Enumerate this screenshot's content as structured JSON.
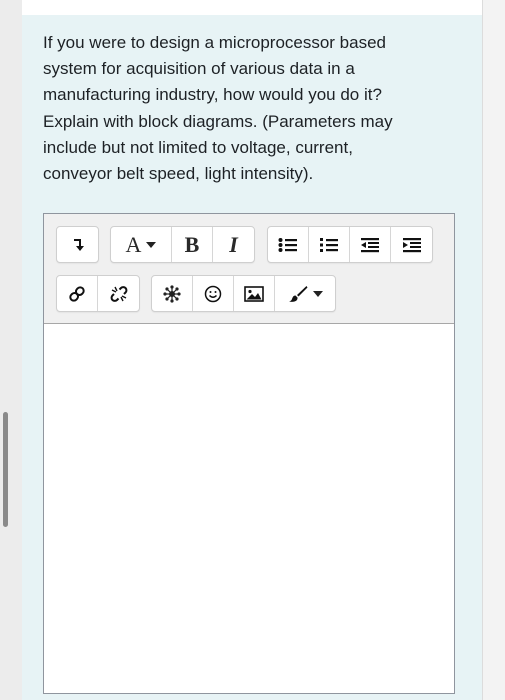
{
  "question": {
    "lines": [
      "If you were to design a microprocessor based",
      "system for acquisition of various data in a",
      "manufacturing industry, how would you do it?",
      "Explain with block diagrams. (Parameters may",
      "include but not limited to voltage, current,",
      "conveyor belt speed, light intensity)."
    ]
  },
  "toolbar": {
    "font_label": "A",
    "bold_label": "B",
    "italic_label": "I",
    "icons": {
      "row1": [
        "expand-arrow-icon",
        "font-color-icon",
        "bold-icon",
        "italic-icon",
        "unordered-list-icon",
        "ordered-list-icon",
        "outdent-icon",
        "indent-icon"
      ],
      "row2": [
        "link-icon",
        "unlink-icon",
        "special-character-icon",
        "emoji-icon",
        "image-icon",
        "paintbrush-icon"
      ]
    }
  },
  "answer_editor": {
    "value": ""
  }
}
